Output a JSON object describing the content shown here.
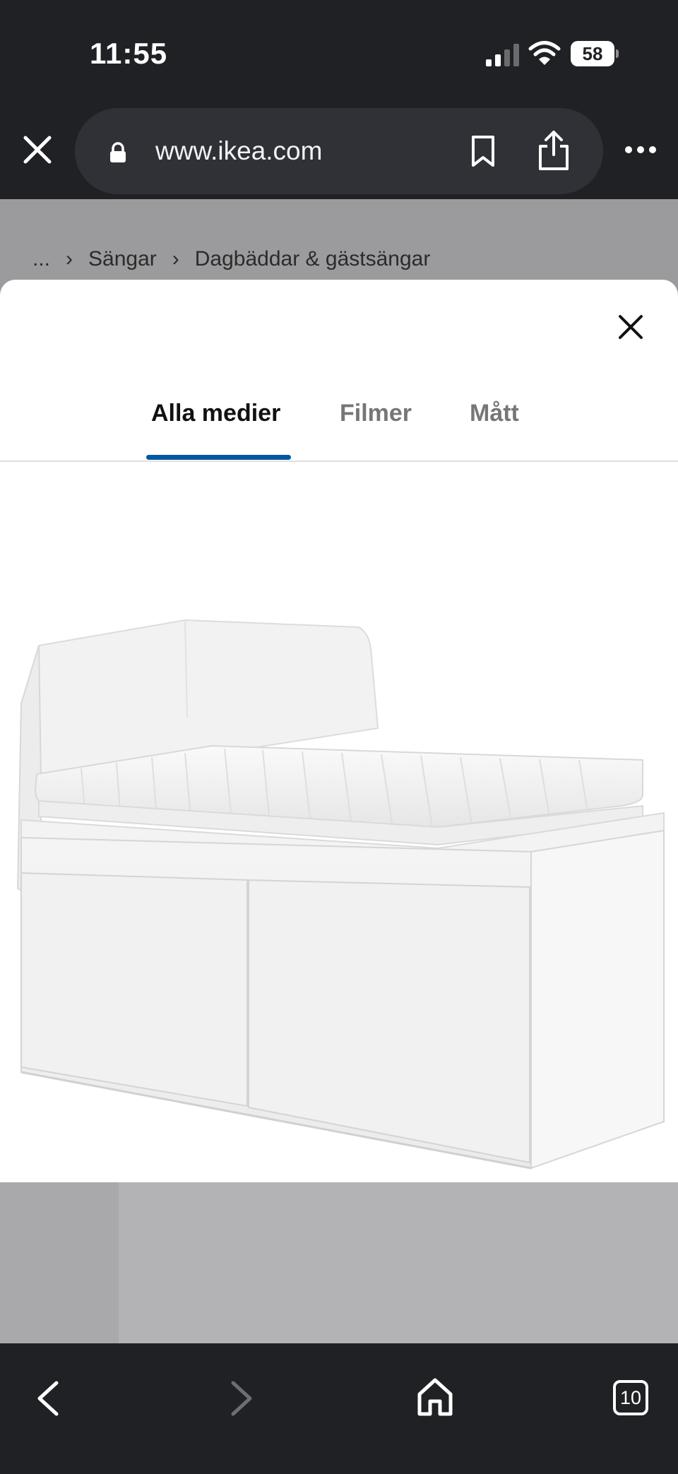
{
  "status_bar": {
    "time": "11:55",
    "battery_level": "58",
    "icons": [
      "signal-icon",
      "wifi-icon",
      "battery-icon"
    ]
  },
  "browser": {
    "url": "www.ikea.com",
    "icons": [
      "close-icon",
      "lock-icon",
      "bookmark-icon",
      "share-icon",
      "more-icon"
    ]
  },
  "breadcrumb": {
    "items": [
      "...",
      "Sängar",
      "Dagbäddar & gästsängar"
    ]
  },
  "modal": {
    "tabs": [
      {
        "label": "Alla medier",
        "active": true
      },
      {
        "label": "Filmer",
        "active": false
      },
      {
        "label": "Mått",
        "active": false
      }
    ]
  },
  "bottom_nav": {
    "tab_count": "10",
    "icons": [
      "back-icon",
      "forward-icon",
      "home-icon",
      "tabs-icon"
    ]
  },
  "colors": {
    "accent": "#0058a3",
    "browser_bg": "#202125"
  }
}
